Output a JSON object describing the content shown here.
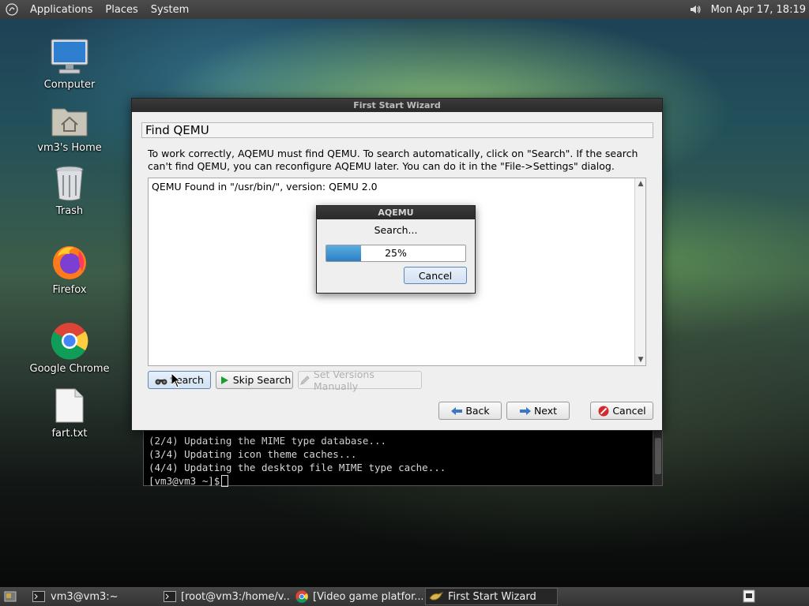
{
  "top_panel": {
    "menus": [
      "Applications",
      "Places",
      "System"
    ],
    "clock": "Mon Apr 17, 18:19"
  },
  "desktop": {
    "icons": [
      {
        "label": "Computer",
        "icon": "computer-icon"
      },
      {
        "label": "vm3's Home",
        "icon": "home-folder-icon"
      },
      {
        "label": "Trash",
        "icon": "trash-icon"
      },
      {
        "label": "Firefox",
        "icon": "firefox-icon"
      },
      {
        "label": "Google Chrome",
        "icon": "chrome-icon"
      },
      {
        "label": "fart.txt",
        "icon": "text-file-icon"
      }
    ]
  },
  "terminal": {
    "lines": [
      "(2/4) Updating the MIME type database...",
      "(3/4) Updating icon theme caches...",
      "(4/4) Updating the desktop file MIME type cache..."
    ],
    "prompt": "[vm3@vm3 ~]$"
  },
  "wizard": {
    "title": "First Start Wizard",
    "page_title": "Find QEMU",
    "description": "To work correctly, AQEMU must find QEMU. To search automatically, click on \"Search\". If the search can't find QEMU, you can reconfigure AQEMU later. You can do it in the \"File->Settings\" dialog.",
    "log_text": "QEMU Found in \"/usr/bin/\", version: QEMU 2.0",
    "buttons": {
      "search": "Search",
      "skip_search": "Skip Search",
      "set_versions": "Set Versions Manually",
      "back": "Back",
      "next": "Next",
      "cancel": "Cancel"
    }
  },
  "progress_dialog": {
    "title": "AQEMU",
    "message": "Search...",
    "progress_percent": 25,
    "progress_label": "25%",
    "cancel": "Cancel"
  },
  "taskbar": {
    "tasks": [
      {
        "label": "vm3@vm3:~",
        "icon": "terminal-icon"
      },
      {
        "label": "[root@vm3:/home/v...",
        "icon": "terminal-icon"
      },
      {
        "label": "[Video game platfor...",
        "icon": "chrome-icon"
      },
      {
        "label": "First Start Wizard",
        "icon": "aqemu-icon"
      }
    ]
  },
  "colors": {
    "accent_progress": "#2b7fc4",
    "panel_bg": "#3a3a3a"
  }
}
